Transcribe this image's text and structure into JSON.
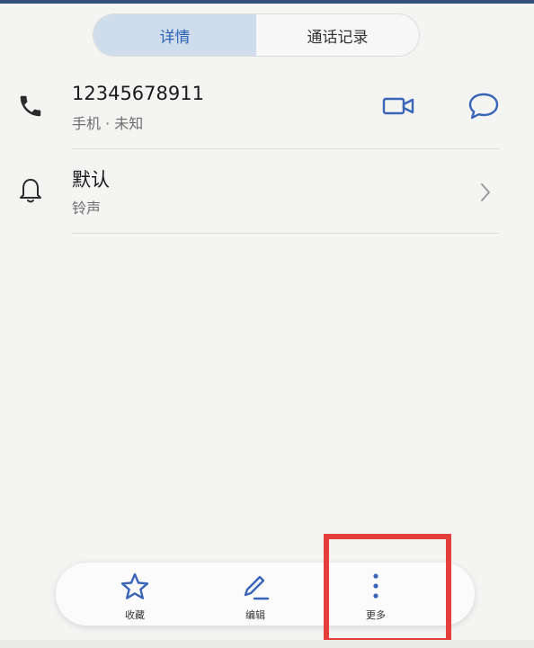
{
  "tabs": [
    {
      "label": "详情",
      "active": true
    },
    {
      "label": "通话记录",
      "active": false
    }
  ],
  "contact": {
    "number": "12345678911",
    "number_type": "手机 · 未知"
  },
  "ringtone": {
    "value": "默认",
    "label": "铃声"
  },
  "bottom_actions": [
    {
      "label": "收藏",
      "icon": "star-icon"
    },
    {
      "label": "编辑",
      "icon": "pencil-icon"
    },
    {
      "label": "更多",
      "icon": "more-vertical-icon"
    }
  ],
  "colors": {
    "accent": "#2a63b6",
    "tab_active_bg": "#cfdcec",
    "highlight": "#e43f3c",
    "icon_blue": "#3a64b8"
  }
}
